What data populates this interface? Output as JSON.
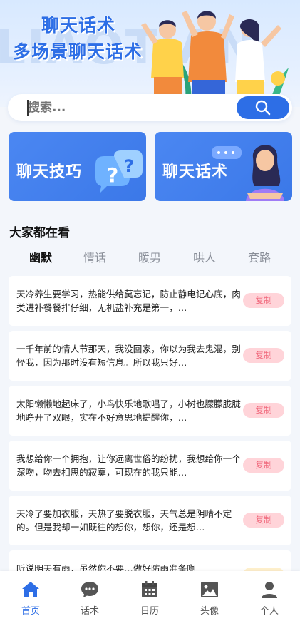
{
  "hero": {
    "title_line1": "聊天话术",
    "title_line2": "多场景聊天话术",
    "watermark": "LIAOTIAN"
  },
  "search": {
    "placeholder": "搜索...",
    "button_icon": "search-icon"
  },
  "cards": [
    {
      "label": "聊天技巧",
      "icon": "question-bubble-icon"
    },
    {
      "label": "聊天话术",
      "icon": "woman-illustration"
    }
  ],
  "section": {
    "title": "大家都在看"
  },
  "tabs": [
    {
      "label": "幽默",
      "active": true
    },
    {
      "label": "情话",
      "active": false
    },
    {
      "label": "暖男",
      "active": false
    },
    {
      "label": "哄人",
      "active": false
    },
    {
      "label": "套路",
      "active": false
    }
  ],
  "items": [
    {
      "text": "天冷养生要学习，热能供给莫忘记，防止静电记心底，肉类进补餐餐排仔细，无机盐补充是第一，…",
      "copy": "复制"
    },
    {
      "text": "一千年前的情人节那天，我没回家，你以为我去鬼混，别怪我，因为那时没有短信息。所以我只好…",
      "copy": "复制"
    },
    {
      "text": "太阳懒懒地起床了，小鸟快乐地歌唱了，小树也朦朦胧胧地睁开了双眼，实在不好意思地提醒你，…",
      "copy": "复制"
    },
    {
      "text": "我想给你一个拥抱，让你远离世俗的纷扰，我想给你一个深吻，吻去相思的寂寞，可现在的我只能…",
      "copy": "复制"
    },
    {
      "text": "天冷了要加衣服，天热了要脱衣服，天气总是阴晴不定的。但是我却一如既往的想你，想你，还是想…",
      "copy": "复制"
    },
    {
      "text": "听说明天有雨，虽然你不要…做好防雨准备啊",
      "copy": ""
    }
  ],
  "tabbar": [
    {
      "label": "首页",
      "icon": "home-icon",
      "active": true
    },
    {
      "label": "话术",
      "icon": "chat-icon",
      "active": false
    },
    {
      "label": "日历",
      "icon": "calendar-icon",
      "active": false
    },
    {
      "label": "头像",
      "icon": "image-icon",
      "active": false
    },
    {
      "label": "个人",
      "icon": "person-icon",
      "active": false
    }
  ],
  "colors": {
    "accent": "#2d6ee6",
    "copy_bg": "#ffd4d9",
    "copy_text": "#f0667a"
  }
}
